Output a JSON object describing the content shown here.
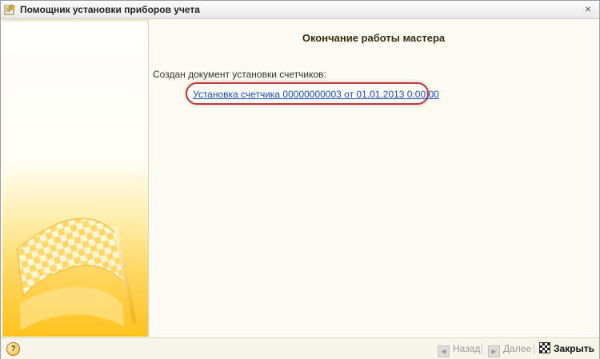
{
  "window": {
    "title": "Помощник установки приборов учета",
    "close_glyph": "×"
  },
  "content": {
    "heading": "Окончание работы мастера",
    "created_label": "Создан документ установки счетчиков:",
    "document_link": "Установка счетчика 00000000003 от 01.01.2013 0:00:00"
  },
  "footer": {
    "help_glyph": "?",
    "back_label": "Назад",
    "next_label": "Далее",
    "close_label": "Закрыть"
  },
  "icons": {
    "title": "wizard-app-icon",
    "sidebar": "checkered-flag-icon",
    "help": "help-icon",
    "back": "back-arrow-icon",
    "next": "next-arrow-icon",
    "close": "checkered-flag-icon"
  },
  "colors": {
    "link": "#1c4fb8",
    "highlight_oval": "#c2393d",
    "sidebar_gradient_bottom": "#ffc21c"
  }
}
